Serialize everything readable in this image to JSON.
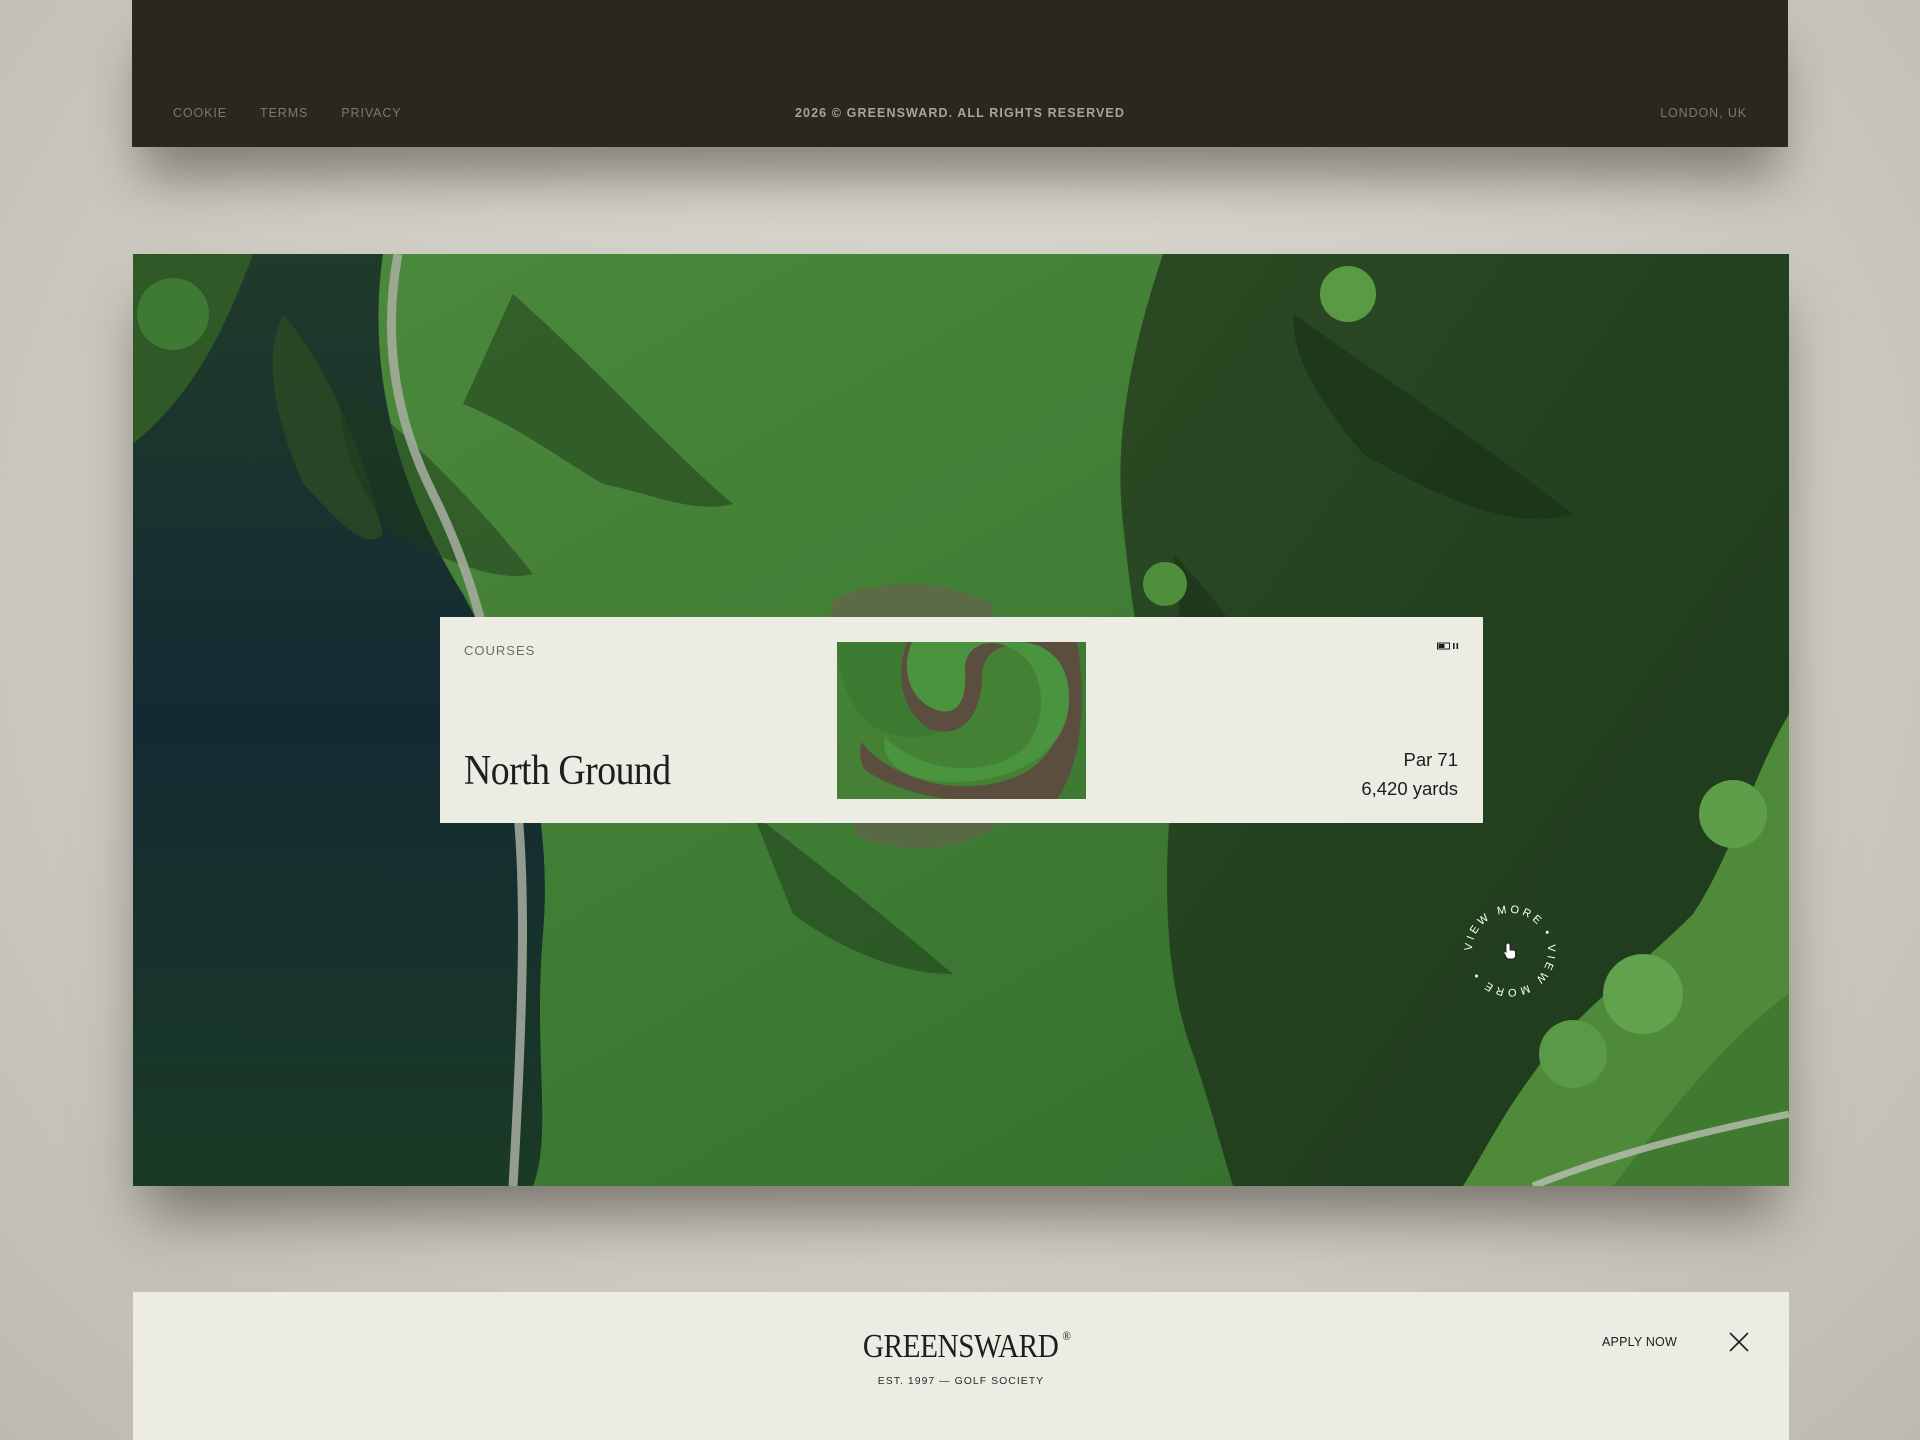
{
  "footer": {
    "links": [
      "COOKIE",
      "TERMS",
      "PRIVACY"
    ],
    "copyright": "2026 © GREENSWARD. ALL RIGHTS RESERVED",
    "location": "LONDON, UK"
  },
  "course_card": {
    "label": "COURSES",
    "title": "North Ground",
    "par": "Par 71",
    "yards": "6,420 yards",
    "controls_icon": "progress-pause-icon"
  },
  "view_more": {
    "text": "VIEW MORE • VIEW MORE •",
    "icon": "hand-pointer-icon"
  },
  "header": {
    "logo": "GREENSWARD",
    "logo_mark": "®",
    "tagline": "EST. 1997 — GOLF SOCIETY",
    "apply_label": "APPLY NOW",
    "close_icon": "close-icon"
  },
  "colors": {
    "footer_bg": "#2a2720",
    "card_bg": "#ecece5",
    "page_bg": "#d4d2c9",
    "grass": "#3f7a34",
    "water": "#1c3a25"
  }
}
